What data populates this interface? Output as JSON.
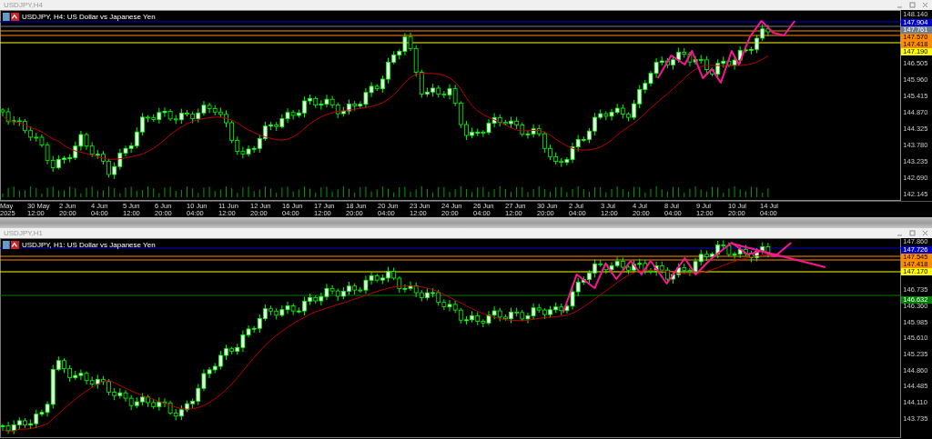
{
  "windows": [
    {
      "title": "USDJPY,H4",
      "header": "USDJPY, H4: US Dollar vs Japanese Yen",
      "show_volume": true,
      "price_ticks": [
        "148.140",
        "146.505",
        "145.960",
        "145.415",
        "144.870",
        "144.325",
        "143.780",
        "143.235",
        "142.690",
        "142.145"
      ],
      "level_tags": [
        {
          "price": "147.904",
          "color": "#0000cc"
        },
        {
          "price": "147.761",
          "color": "#708090"
        },
        {
          "price": "147.570",
          "color": "#ff8c00"
        },
        {
          "price": "147.418",
          "color": "#ff8c00"
        },
        {
          "price": "147.190",
          "color": "#ffff00"
        }
      ],
      "time_labels": [
        "May 2025",
        "30 May 12:00",
        "2 Jun 20:00",
        "4 Jun 04:00",
        "5 Jun 12:00",
        "6 Jun 20:00",
        "10 Jun 04:00",
        "11 Jun 12:00",
        "12 Jun 20:00",
        "16 Jun 04:00",
        "17 Jun 12:00",
        "18 Jun 20:00",
        "20 Jun 04:00",
        "23 Jun 12:00",
        "24 Jun 20:00",
        "26 Jun 04:00",
        "27 Jun 12:00",
        "30 Jun 20:00",
        "2 Jul 04:00",
        "3 Jul 12:00",
        "4 Jul 20:00",
        "8 Jul 04:00",
        "9 Jul 12:00",
        "10 Jul 20:00",
        "14 Jul 04:00"
      ]
    },
    {
      "title": "USDJPY,H1",
      "header": "USDJPY, H1: US Dollar vs Japanese Yen",
      "show_volume": false,
      "price_ticks": [
        "147.860",
        "146.735",
        "146.360",
        "145.985",
        "145.610",
        "145.235",
        "144.860",
        "144.485",
        "144.110",
        "143.735"
      ],
      "level_tags": [
        {
          "price": "147.726",
          "color": "#0000cc"
        },
        {
          "price": "147.545",
          "color": "#ff8c00"
        },
        {
          "price": "147.418",
          "color": "#ff8c00"
        },
        {
          "price": "147.170",
          "color": "#ffff00"
        },
        {
          "price": "146.632",
          "color": "#008000"
        }
      ]
    }
  ]
}
